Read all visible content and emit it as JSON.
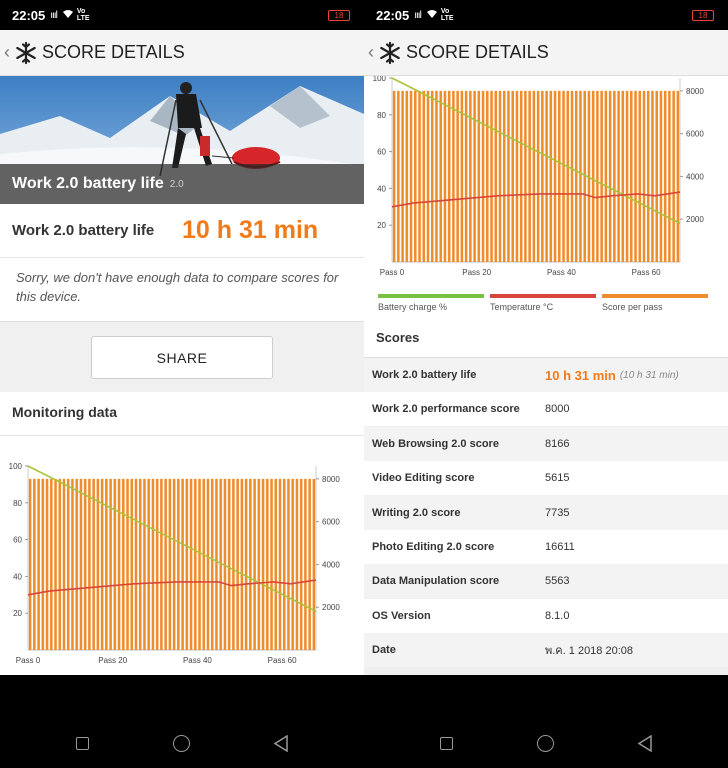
{
  "statusbar": {
    "time": "22:05",
    "signal": "ıııl",
    "volte_top": "Vo",
    "volte_bottom": "LTE",
    "battery": "18"
  },
  "appbar": {
    "back": "‹",
    "title": "SCORE DETAILS"
  },
  "left": {
    "hero_label": "Work 2.0 battery life",
    "hero_version": "2.0",
    "result_label": "Work 2.0 battery life",
    "result_value": "10 h 31 min",
    "sorry_text": "Sorry, we don't have enough data to compare scores for this device.",
    "share_label": "SHARE",
    "monitoring_title": "Monitoring data"
  },
  "right": {
    "legend": [
      {
        "label": "Battery charge %",
        "color": "#78c142"
      },
      {
        "label": "Temperature °C",
        "color": "#d9453b"
      },
      {
        "label": "Score per pass",
        "color": "#ef8c2b"
      }
    ],
    "scores_title": "Scores",
    "scores": [
      {
        "name": "Work 2.0 battery life",
        "value": "10 h 31 min",
        "sub": "(10 h 31 min)"
      },
      {
        "name": "Work 2.0 performance score",
        "value": "8000"
      },
      {
        "name": "Web Browsing 2.0 score",
        "value": "8166"
      },
      {
        "name": "Video Editing score",
        "value": "5615"
      },
      {
        "name": "Writing 2.0 score",
        "value": "7735"
      },
      {
        "name": "Photo Editing 2.0 score",
        "value": "16611"
      },
      {
        "name": "Data Manipulation score",
        "value": "5563"
      },
      {
        "name": "OS Version",
        "value": "8.1.0"
      },
      {
        "name": "Date",
        "value": "พ.ค. 1 2018 20:08"
      }
    ]
  },
  "chart_data": {
    "type": "bar",
    "x_ticks": [
      "Pass 0",
      "Pass 20",
      "Pass 40",
      "Pass 60"
    ],
    "x_range": [
      0,
      68
    ],
    "y_left_ticks": [
      "20",
      "40",
      "60",
      "80",
      "100"
    ],
    "y_left_range": [
      0,
      100
    ],
    "y_right_ticks": [
      "2000",
      "4000",
      "6000",
      "8000"
    ],
    "y_right_range": [
      0,
      8600
    ],
    "series": [
      {
        "name": "Score per pass",
        "axis": "right",
        "kind": "bar",
        "value_per_pass": 8000,
        "passes": 68,
        "color": "#ef8c2b"
      },
      {
        "name": "Battery charge %",
        "axis": "left",
        "kind": "line",
        "points": [
          [
            0,
            100
          ],
          [
            68,
            21
          ]
        ],
        "color": "#a8c43a"
      },
      {
        "name": "Temperature °C",
        "axis": "left",
        "kind": "line",
        "points": [
          [
            0,
            30
          ],
          [
            5,
            32
          ],
          [
            15,
            34
          ],
          [
            25,
            36
          ],
          [
            35,
            37
          ],
          [
            45,
            37
          ],
          [
            48,
            35
          ],
          [
            52,
            36
          ],
          [
            58,
            37
          ],
          [
            62,
            36
          ],
          [
            68,
            38
          ]
        ],
        "color": "#d9453b"
      }
    ]
  },
  "navbar": {
    "icons": [
      "square-icon",
      "circle-icon",
      "back-triangle-icon"
    ]
  }
}
